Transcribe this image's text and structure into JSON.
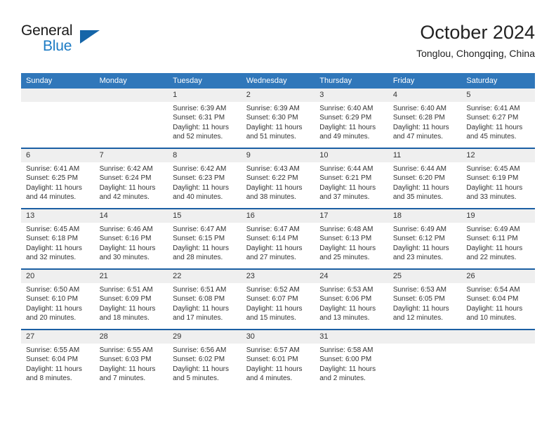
{
  "brand": {
    "name_part1": "General",
    "name_part2": "Blue",
    "triangle_icon": "triangle-icon"
  },
  "header": {
    "month_title": "October 2024",
    "location": "Tonglou, Chongqing, China"
  },
  "colors": {
    "header_blue": "#3077ba",
    "row_divider_blue": "#1b5fa3",
    "daynum_band": "#efefef",
    "brand_blue": "#1c7bc4",
    "text": "#333333"
  },
  "calendar": {
    "weekday_headers": [
      "Sunday",
      "Monday",
      "Tuesday",
      "Wednesday",
      "Thursday",
      "Friday",
      "Saturday"
    ],
    "weeks": [
      [
        {
          "day": "",
          "lines": []
        },
        {
          "day": "",
          "lines": []
        },
        {
          "day": "1",
          "lines": [
            "Sunrise: 6:39 AM",
            "Sunset: 6:31 PM",
            "Daylight: 11 hours",
            "and 52 minutes."
          ]
        },
        {
          "day": "2",
          "lines": [
            "Sunrise: 6:39 AM",
            "Sunset: 6:30 PM",
            "Daylight: 11 hours",
            "and 51 minutes."
          ]
        },
        {
          "day": "3",
          "lines": [
            "Sunrise: 6:40 AM",
            "Sunset: 6:29 PM",
            "Daylight: 11 hours",
            "and 49 minutes."
          ]
        },
        {
          "day": "4",
          "lines": [
            "Sunrise: 6:40 AM",
            "Sunset: 6:28 PM",
            "Daylight: 11 hours",
            "and 47 minutes."
          ]
        },
        {
          "day": "5",
          "lines": [
            "Sunrise: 6:41 AM",
            "Sunset: 6:27 PM",
            "Daylight: 11 hours",
            "and 45 minutes."
          ]
        }
      ],
      [
        {
          "day": "6",
          "lines": [
            "Sunrise: 6:41 AM",
            "Sunset: 6:25 PM",
            "Daylight: 11 hours",
            "and 44 minutes."
          ]
        },
        {
          "day": "7",
          "lines": [
            "Sunrise: 6:42 AM",
            "Sunset: 6:24 PM",
            "Daylight: 11 hours",
            "and 42 minutes."
          ]
        },
        {
          "day": "8",
          "lines": [
            "Sunrise: 6:42 AM",
            "Sunset: 6:23 PM",
            "Daylight: 11 hours",
            "and 40 minutes."
          ]
        },
        {
          "day": "9",
          "lines": [
            "Sunrise: 6:43 AM",
            "Sunset: 6:22 PM",
            "Daylight: 11 hours",
            "and 38 minutes."
          ]
        },
        {
          "day": "10",
          "lines": [
            "Sunrise: 6:44 AM",
            "Sunset: 6:21 PM",
            "Daylight: 11 hours",
            "and 37 minutes."
          ]
        },
        {
          "day": "11",
          "lines": [
            "Sunrise: 6:44 AM",
            "Sunset: 6:20 PM",
            "Daylight: 11 hours",
            "and 35 minutes."
          ]
        },
        {
          "day": "12",
          "lines": [
            "Sunrise: 6:45 AM",
            "Sunset: 6:19 PM",
            "Daylight: 11 hours",
            "and 33 minutes."
          ]
        }
      ],
      [
        {
          "day": "13",
          "lines": [
            "Sunrise: 6:45 AM",
            "Sunset: 6:18 PM",
            "Daylight: 11 hours",
            "and 32 minutes."
          ]
        },
        {
          "day": "14",
          "lines": [
            "Sunrise: 6:46 AM",
            "Sunset: 6:16 PM",
            "Daylight: 11 hours",
            "and 30 minutes."
          ]
        },
        {
          "day": "15",
          "lines": [
            "Sunrise: 6:47 AM",
            "Sunset: 6:15 PM",
            "Daylight: 11 hours",
            "and 28 minutes."
          ]
        },
        {
          "day": "16",
          "lines": [
            "Sunrise: 6:47 AM",
            "Sunset: 6:14 PM",
            "Daylight: 11 hours",
            "and 27 minutes."
          ]
        },
        {
          "day": "17",
          "lines": [
            "Sunrise: 6:48 AM",
            "Sunset: 6:13 PM",
            "Daylight: 11 hours",
            "and 25 minutes."
          ]
        },
        {
          "day": "18",
          "lines": [
            "Sunrise: 6:49 AM",
            "Sunset: 6:12 PM",
            "Daylight: 11 hours",
            "and 23 minutes."
          ]
        },
        {
          "day": "19",
          "lines": [
            "Sunrise: 6:49 AM",
            "Sunset: 6:11 PM",
            "Daylight: 11 hours",
            "and 22 minutes."
          ]
        }
      ],
      [
        {
          "day": "20",
          "lines": [
            "Sunrise: 6:50 AM",
            "Sunset: 6:10 PM",
            "Daylight: 11 hours",
            "and 20 minutes."
          ]
        },
        {
          "day": "21",
          "lines": [
            "Sunrise: 6:51 AM",
            "Sunset: 6:09 PM",
            "Daylight: 11 hours",
            "and 18 minutes."
          ]
        },
        {
          "day": "22",
          "lines": [
            "Sunrise: 6:51 AM",
            "Sunset: 6:08 PM",
            "Daylight: 11 hours",
            "and 17 minutes."
          ]
        },
        {
          "day": "23",
          "lines": [
            "Sunrise: 6:52 AM",
            "Sunset: 6:07 PM",
            "Daylight: 11 hours",
            "and 15 minutes."
          ]
        },
        {
          "day": "24",
          "lines": [
            "Sunrise: 6:53 AM",
            "Sunset: 6:06 PM",
            "Daylight: 11 hours",
            "and 13 minutes."
          ]
        },
        {
          "day": "25",
          "lines": [
            "Sunrise: 6:53 AM",
            "Sunset: 6:05 PM",
            "Daylight: 11 hours",
            "and 12 minutes."
          ]
        },
        {
          "day": "26",
          "lines": [
            "Sunrise: 6:54 AM",
            "Sunset: 6:04 PM",
            "Daylight: 11 hours",
            "and 10 minutes."
          ]
        }
      ],
      [
        {
          "day": "27",
          "lines": [
            "Sunrise: 6:55 AM",
            "Sunset: 6:04 PM",
            "Daylight: 11 hours",
            "and 8 minutes."
          ]
        },
        {
          "day": "28",
          "lines": [
            "Sunrise: 6:55 AM",
            "Sunset: 6:03 PM",
            "Daylight: 11 hours",
            "and 7 minutes."
          ]
        },
        {
          "day": "29",
          "lines": [
            "Sunrise: 6:56 AM",
            "Sunset: 6:02 PM",
            "Daylight: 11 hours",
            "and 5 minutes."
          ]
        },
        {
          "day": "30",
          "lines": [
            "Sunrise: 6:57 AM",
            "Sunset: 6:01 PM",
            "Daylight: 11 hours",
            "and 4 minutes."
          ]
        },
        {
          "day": "31",
          "lines": [
            "Sunrise: 6:58 AM",
            "Sunset: 6:00 PM",
            "Daylight: 11 hours",
            "and 2 minutes."
          ]
        },
        {
          "day": "",
          "lines": []
        },
        {
          "day": "",
          "lines": []
        }
      ]
    ]
  }
}
